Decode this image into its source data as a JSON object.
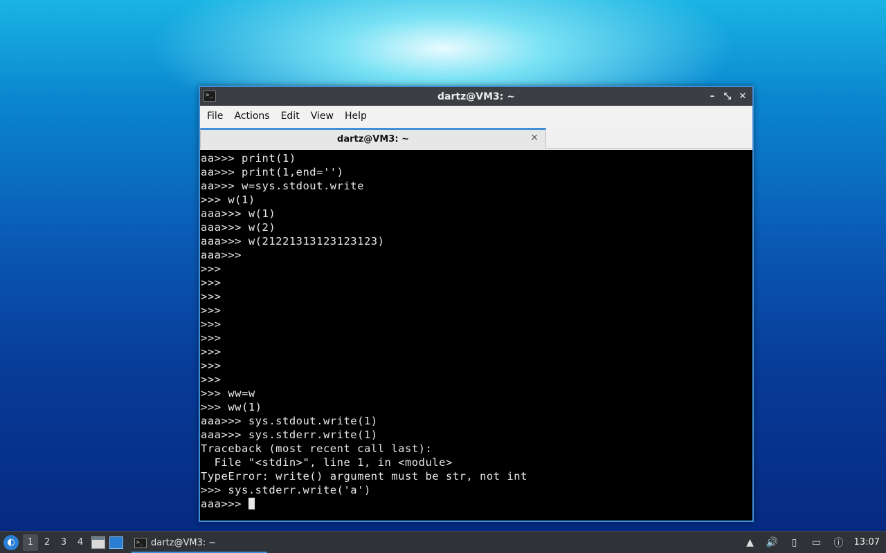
{
  "window": {
    "title": "dartz@VM3: ~",
    "app_icon": ">_",
    "controls": {
      "minimize": "–",
      "maximize": "⤡",
      "close": "✕"
    }
  },
  "menubar": {
    "items": [
      "File",
      "Actions",
      "Edit",
      "View",
      "Help"
    ]
  },
  "tab": {
    "label": "dartz@VM3: ~",
    "close": "×"
  },
  "terminal": {
    "lines": [
      "aa>>> print(1)",
      "aa>>> print(1,end='')",
      "aa>>> w=sys.stdout.write",
      ">>> w(1)",
      "aaa>>> w(1)",
      "aaa>>> w(2)",
      "aaa>>> w(21221313123123123)",
      "aaa>>>",
      ">>>",
      ">>>",
      ">>>",
      ">>>",
      ">>>",
      ">>>",
      ">>>",
      ">>>",
      ">>>",
      ">>> ww=w",
      ">>> ww(1)",
      "aaa>>> sys.stdout.write(1)",
      "aaa>>> sys.stderr.write(1)",
      "Traceback (most recent call last):",
      "  File \"<stdin>\", line 1, in <module>",
      "TypeError: write() argument must be str, not int",
      ">>> sys.stderr.write('a')"
    ],
    "prompt_line": "aaa>>> "
  },
  "taskbar": {
    "start_icon": "start-menu-icon",
    "workspaces": [
      "1",
      "2",
      "3",
      "4"
    ],
    "active_workspace": "1",
    "task_label": "dartz@VM3: ~",
    "clock": "13:07"
  },
  "colors": {
    "accent": "#3f8fd9",
    "terminal_bg": "#000000",
    "terminal_fg": "#e8e8e8",
    "titlebar_bg": "#3b3e43",
    "taskbar_bg": "#2f3237"
  }
}
